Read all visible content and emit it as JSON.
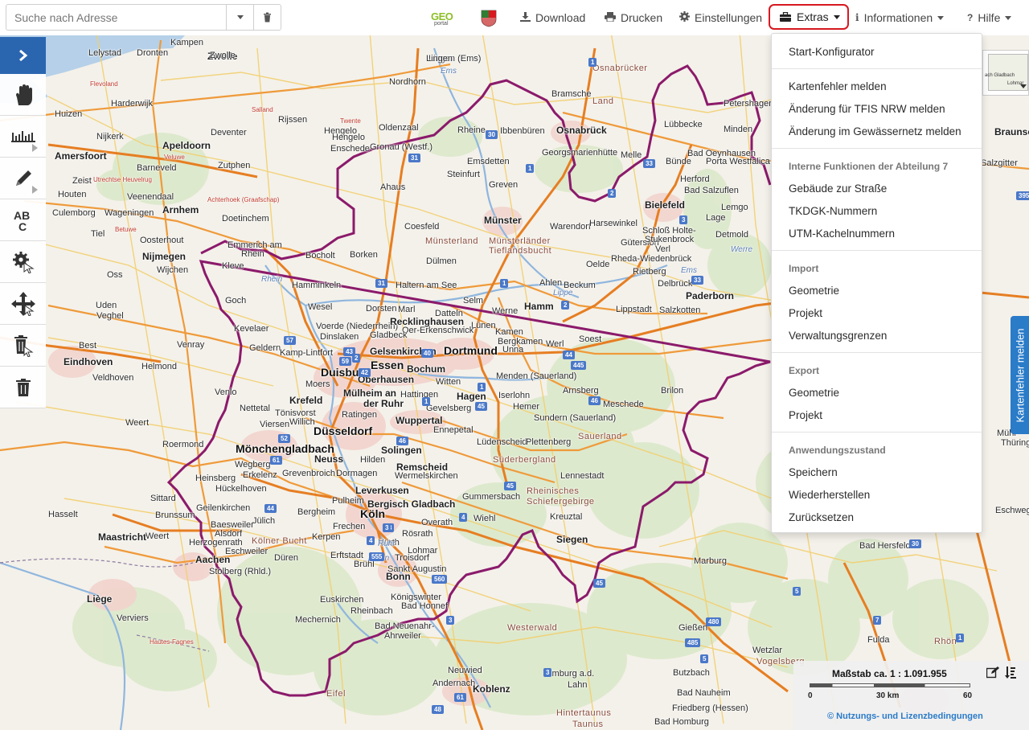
{
  "search": {
    "placeholder": "Suche nach Adresse"
  },
  "nav": {
    "download": "Download",
    "print": "Drucken",
    "settings": "Einstellungen",
    "extras": "Extras",
    "info": "Informationen",
    "help": "Hilfe"
  },
  "logos": {
    "geoportal_top": "GEO",
    "geoportal_bottom": "portal"
  },
  "extras_menu": {
    "start_configurator": "Start-Konfigurator",
    "report_map_error": "Kartenfehler melden",
    "report_tfis_change": "Änderung für TFIS NRW melden",
    "report_water_change": "Änderung im Gewässernetz melden",
    "internal_header": "Interne Funktionen der Abteilung 7",
    "building_street": "Gebäude zur Straße",
    "tkdgk": "TKDGK-Nummern",
    "utm": "UTM-Kachelnummern",
    "import_header": "Import",
    "import_geometry": "Geometrie",
    "import_project": "Projekt",
    "import_admin": "Verwaltungsgrenzen",
    "export_header": "Export",
    "export_geometry": "Geometrie",
    "export_project": "Projekt",
    "state_header": "Anwendungszustand",
    "save": "Speichern",
    "restore": "Wiederherstellen",
    "reset": "Zurücksetzen"
  },
  "report_tab": "Kartenfehler melden",
  "overview": {
    "label1": "ach Gladbach",
    "label2": "Lohmar"
  },
  "scale": {
    "label": "Maßstab ca. 1 : 1.091.955",
    "tick_start": "0",
    "tick_mid": "30 km",
    "tick_end": "60",
    "license": "© Nutzungs- und Lizenzbedingungen"
  },
  "colors": {
    "accent": "#2a66b0",
    "highlight": "#d71920",
    "border_nrw": "#8b1a6b"
  },
  "map": {
    "labels": [
      {
        "t": "Kampen",
        "c": ""
      },
      {
        "t": "Lelystad",
        "c": ""
      },
      {
        "t": "Dronten",
        "c": ""
      },
      {
        "t": "Zwolle",
        "c": "mid"
      },
      {
        "t": "Lingen (Ems)",
        "c": ""
      },
      {
        "t": "Nordhorn",
        "c": ""
      },
      {
        "t": "Osnabrücker",
        "c": "reg"
      },
      {
        "t": "Land",
        "c": "reg"
      },
      {
        "t": "Bramsche",
        "c": ""
      },
      {
        "t": "Petershagen",
        "c": ""
      },
      {
        "t": "Harderwijk",
        "c": ""
      },
      {
        "t": "Flevoland",
        "c": "nl"
      },
      {
        "t": "Salland",
        "c": "nl"
      },
      {
        "t": "Huizen",
        "c": ""
      },
      {
        "t": "Nijkerk",
        "c": ""
      },
      {
        "t": "Rijssen",
        "c": ""
      },
      {
        "t": "Hengelo",
        "c": ""
      },
      {
        "t": "Oldenzaal",
        "c": ""
      },
      {
        "t": "Twente",
        "c": "nl"
      },
      {
        "t": "Rheine",
        "c": ""
      },
      {
        "t": "Ibbenbüren",
        "c": ""
      },
      {
        "t": "Osnabrück",
        "c": "mid"
      },
      {
        "t": "Lübbecke",
        "c": ""
      },
      {
        "t": "Minden",
        "c": ""
      },
      {
        "t": "Amersfoort",
        "c": "mid"
      },
      {
        "t": "Apeldoorn",
        "c": "mid"
      },
      {
        "t": "Veluwe",
        "c": "nl"
      },
      {
        "t": "Deventer",
        "c": ""
      },
      {
        "t": "Hengelo",
        "c": ""
      },
      {
        "t": "Enschede",
        "c": ""
      },
      {
        "t": "Gronau (Westf.)",
        "c": ""
      },
      {
        "t": "Georgsmarienhütte",
        "c": ""
      },
      {
        "t": "Melle",
        "c": ""
      },
      {
        "t": "Bad Oeynhausen",
        "c": ""
      },
      {
        "t": "Porta Westfalica",
        "c": ""
      },
      {
        "t": "Barneveld",
        "c": ""
      },
      {
        "t": "Zutphen",
        "c": ""
      },
      {
        "t": "Emsdetten",
        "c": ""
      },
      {
        "t": "Bünde",
        "c": ""
      },
      {
        "t": "Zeist",
        "c": ""
      },
      {
        "t": "Utrechtse Heuvelrug",
        "c": "nl"
      },
      {
        "t": "Steinfurt",
        "c": ""
      },
      {
        "t": "Herford",
        "c": ""
      },
      {
        "t": "Houten",
        "c": ""
      },
      {
        "t": "Veenendaal",
        "c": ""
      },
      {
        "t": "Achterhoek (Graafschap)",
        "c": "nl"
      },
      {
        "t": "Ahaus",
        "c": ""
      },
      {
        "t": "Greven",
        "c": ""
      },
      {
        "t": "Bad Salzuflen",
        "c": ""
      },
      {
        "t": "Culemborg",
        "c": ""
      },
      {
        "t": "Wageningen",
        "c": ""
      },
      {
        "t": "Arnhem",
        "c": "mid"
      },
      {
        "t": "Doetinchem",
        "c": ""
      },
      {
        "t": "Münster",
        "c": "mid"
      },
      {
        "t": "Warendorf",
        "c": ""
      },
      {
        "t": "Harsewinkel",
        "c": ""
      },
      {
        "t": "Bielefeld",
        "c": "mid"
      },
      {
        "t": "Lemgo",
        "c": ""
      },
      {
        "t": "Tiel",
        "c": ""
      },
      {
        "t": "Betuwe",
        "c": "nl"
      },
      {
        "t": "Coesfeld",
        "c": ""
      },
      {
        "t": "Lage",
        "c": ""
      },
      {
        "t": "Oosterhout",
        "c": ""
      },
      {
        "t": "Emmerich am",
        "c": ""
      },
      {
        "t": "Rhein",
        "c": ""
      },
      {
        "t": "Münsterland",
        "c": "reg"
      },
      {
        "t": "Münsterländer",
        "c": "reg"
      },
      {
        "t": "Tieflandsbucht",
        "c": "reg"
      },
      {
        "t": "Gütersloh",
        "c": ""
      },
      {
        "t": "Schloß Holte-",
        "c": ""
      },
      {
        "t": "Stukenbrock",
        "c": ""
      },
      {
        "t": "Detmold",
        "c": ""
      },
      {
        "t": "Nijmegen",
        "c": "mid"
      },
      {
        "t": "Kleve",
        "c": ""
      },
      {
        "t": "Bocholt",
        "c": ""
      },
      {
        "t": "Borken",
        "c": ""
      },
      {
        "t": "Dülmen",
        "c": ""
      },
      {
        "t": "Rheda-Wiedenbrück",
        "c": ""
      },
      {
        "t": "Verl",
        "c": ""
      },
      {
        "t": "Oss",
        "c": ""
      },
      {
        "t": "Wijchen",
        "c": ""
      },
      {
        "t": "Oelde",
        "c": ""
      },
      {
        "t": "Rietberg",
        "c": ""
      },
      {
        "t": "Hamminkeln",
        "c": ""
      },
      {
        "t": "Haltern am See",
        "c": ""
      },
      {
        "t": "Ahlen",
        "c": ""
      },
      {
        "t": "Beckum",
        "c": ""
      },
      {
        "t": "Delbrück",
        "c": ""
      },
      {
        "t": "Goch",
        "c": ""
      },
      {
        "t": "Wesel",
        "c": ""
      },
      {
        "t": "Marl",
        "c": ""
      },
      {
        "t": "Selm",
        "c": ""
      },
      {
        "t": "Hamm",
        "c": "mid"
      },
      {
        "t": "Paderborn",
        "c": "mid"
      },
      {
        "t": "Uden",
        "c": ""
      },
      {
        "t": "Dorsten",
        "c": ""
      },
      {
        "t": "Datteln",
        "c": ""
      },
      {
        "t": "Werne",
        "c": ""
      },
      {
        "t": "Lippstadt",
        "c": ""
      },
      {
        "t": "Salzkotten",
        "c": ""
      },
      {
        "t": "Veghel",
        "c": ""
      },
      {
        "t": "Kevelaer",
        "c": ""
      },
      {
        "t": "Voerde (Niederrhein)",
        "c": ""
      },
      {
        "t": "Recklinghausen",
        "c": "mid"
      },
      {
        "t": "Lünen",
        "c": ""
      },
      {
        "t": "Dinslaken",
        "c": ""
      },
      {
        "t": "Oer-Erkenschwick",
        "c": ""
      },
      {
        "t": "Kamen",
        "c": ""
      },
      {
        "t": "Gladbeck",
        "c": ""
      },
      {
        "t": "Bergkamen",
        "c": ""
      },
      {
        "t": "Soest",
        "c": ""
      },
      {
        "t": "Best",
        "c": ""
      },
      {
        "t": "Geldern",
        "c": ""
      },
      {
        "t": "Venray",
        "c": ""
      },
      {
        "t": "Kamp-Lintfort",
        "c": ""
      },
      {
        "t": "Gelsenkirchen",
        "c": "mid"
      },
      {
        "t": "Dortmund",
        "c": "big"
      },
      {
        "t": "Unna",
        "c": ""
      },
      {
        "t": "Werl",
        "c": ""
      },
      {
        "t": "Eindhoven",
        "c": "mid"
      },
      {
        "t": "Helmond",
        "c": ""
      },
      {
        "t": "Duisburg",
        "c": "big"
      },
      {
        "t": "Essen",
        "c": "big"
      },
      {
        "t": "Bochum",
        "c": "mid"
      },
      {
        "t": "Oberhausen",
        "c": "mid"
      },
      {
        "t": "Veldhoven",
        "c": ""
      },
      {
        "t": "Moers",
        "c": ""
      },
      {
        "t": "Menden (Sauerland)",
        "c": ""
      },
      {
        "t": "Witten",
        "c": ""
      },
      {
        "t": "Mülheim an",
        "c": "mid"
      },
      {
        "t": "der Ruhr",
        "c": "mid"
      },
      {
        "t": "Arnsberg",
        "c": ""
      },
      {
        "t": "Brilon",
        "c": ""
      },
      {
        "t": "Venlo",
        "c": ""
      },
      {
        "t": "Hattingen",
        "c": ""
      },
      {
        "t": "Hagen",
        "c": "mid"
      },
      {
        "t": "Iserlohn",
        "c": ""
      },
      {
        "t": "Krefeld",
        "c": "mid"
      },
      {
        "t": "Ratingen",
        "c": ""
      },
      {
        "t": "Gevelsberg",
        "c": ""
      },
      {
        "t": "Hemer",
        "c": ""
      },
      {
        "t": "Meschede",
        "c": ""
      },
      {
        "t": "Nettetal",
        "c": ""
      },
      {
        "t": "Tönisvorst",
        "c": ""
      },
      {
        "t": "Sundern (Sauerland)",
        "c": ""
      },
      {
        "t": "Weert",
        "c": ""
      },
      {
        "t": "Viersen",
        "c": ""
      },
      {
        "t": "Willich",
        "c": ""
      },
      {
        "t": "Wuppertal",
        "c": "mid"
      },
      {
        "t": "Düsseldorf",
        "c": "big"
      },
      {
        "t": "Ennepetal",
        "c": ""
      },
      {
        "t": "Roermond",
        "c": ""
      },
      {
        "t": "Lüdenscheid",
        "c": ""
      },
      {
        "t": "Plettenberg",
        "c": ""
      },
      {
        "t": "Sauerland",
        "c": "reg"
      },
      {
        "t": "Mönchengladbach",
        "c": "big"
      },
      {
        "t": "Solingen",
        "c": "mid"
      },
      {
        "t": "Neuss",
        "c": "mid"
      },
      {
        "t": "Hilden",
        "c": ""
      },
      {
        "t": "Süderbergland",
        "c": "reg"
      },
      {
        "t": "Wegberg",
        "c": ""
      },
      {
        "t": "Remscheid",
        "c": "mid"
      },
      {
        "t": "Heinsberg",
        "c": ""
      },
      {
        "t": "Erkelenz",
        "c": ""
      },
      {
        "t": "Grevenbroich",
        "c": ""
      },
      {
        "t": "Dormagen",
        "c": ""
      },
      {
        "t": "Wermelskirchen",
        "c": ""
      },
      {
        "t": "Lennestadt",
        "c": ""
      },
      {
        "t": "Hückelhoven",
        "c": ""
      },
      {
        "t": "Leverkusen",
        "c": "mid"
      },
      {
        "t": "Gummersbach",
        "c": ""
      },
      {
        "t": "Rheinisches",
        "c": "reg"
      },
      {
        "t": "Schiefergebirge",
        "c": "reg"
      },
      {
        "t": "Sittard",
        "c": ""
      },
      {
        "t": "Geilenkirchen",
        "c": ""
      },
      {
        "t": "Pulheim",
        "c": ""
      },
      {
        "t": "Bergisch Gladbach",
        "c": "mid"
      },
      {
        "t": "Brunssum",
        "c": ""
      },
      {
        "t": "Bergheim",
        "c": ""
      },
      {
        "t": "Köln",
        "c": "big"
      },
      {
        "t": "Kreuztal",
        "c": ""
      },
      {
        "t": "Hasselt",
        "c": ""
      },
      {
        "t": "Jülich",
        "c": ""
      },
      {
        "t": "Baesweiler",
        "c": ""
      },
      {
        "t": "Frechen",
        "c": ""
      },
      {
        "t": "Overath",
        "c": ""
      },
      {
        "t": "Wiehl",
        "c": ""
      },
      {
        "t": "Alsdorf",
        "c": ""
      },
      {
        "t": "Kerpen",
        "c": ""
      },
      {
        "t": "Rösrath",
        "c": ""
      },
      {
        "t": "Siegen",
        "c": "mid"
      },
      {
        "t": "Maastricht",
        "c": "mid"
      },
      {
        "t": "Weert",
        "c": ""
      },
      {
        "t": "Herzogenrath",
        "c": ""
      },
      {
        "t": "Kölner Bucht",
        "c": "reg"
      },
      {
        "t": "Eschweiler",
        "c": ""
      },
      {
        "t": "Hürth",
        "c": ""
      },
      {
        "t": "Lohmar",
        "c": ""
      },
      {
        "t": "Düren",
        "c": ""
      },
      {
        "t": "Erftstadt",
        "c": ""
      },
      {
        "t": "Troisdorf",
        "c": ""
      },
      {
        "t": "Aachen",
        "c": "mid"
      },
      {
        "t": "Brühl",
        "c": ""
      },
      {
        "t": "Marburg",
        "c": ""
      },
      {
        "t": "Stolberg (Rhld.)",
        "c": ""
      },
      {
        "t": "Sankt Augustin",
        "c": ""
      },
      {
        "t": "Bonn",
        "c": "mid"
      },
      {
        "t": "Liège",
        "c": "mid"
      },
      {
        "t": "Euskirchen",
        "c": ""
      },
      {
        "t": "Königswinter",
        "c": ""
      },
      {
        "t": "Bad Honnef",
        "c": ""
      },
      {
        "t": "Rheinbach",
        "c": ""
      },
      {
        "t": "Verviers",
        "c": ""
      },
      {
        "t": "Mechernich",
        "c": ""
      },
      {
        "t": "Westerwald",
        "c": "reg"
      },
      {
        "t": "Gießen",
        "c": ""
      },
      {
        "t": "Hautes-Fagnes",
        "c": "nl"
      },
      {
        "t": "Bad Neuenahr-",
        "c": ""
      },
      {
        "t": "Ahrweiler",
        "c": ""
      },
      {
        "t": "Wetzlar",
        "c": ""
      },
      {
        "t": "Vogelsberg",
        "c": "reg"
      },
      {
        "t": "Neuwied",
        "c": ""
      },
      {
        "t": "Limburg a.d.",
        "c": ""
      },
      {
        "t": "Lahn",
        "c": ""
      },
      {
        "t": "Butzbach",
        "c": ""
      },
      {
        "t": "Andernach",
        "c": ""
      },
      {
        "t": "Koblenz",
        "c": "mid"
      },
      {
        "t": "Bad Nauheim",
        "c": ""
      },
      {
        "t": "Eifel",
        "c": "reg"
      },
      {
        "t": "Friedberg (Hessen)",
        "c": ""
      },
      {
        "t": "Hintertaunus",
        "c": "reg"
      },
      {
        "t": "Taunus",
        "c": "reg"
      },
      {
        "t": "Bad Homburg",
        "c": ""
      },
      {
        "t": "Bad Hersfeld",
        "c": ""
      },
      {
        "t": "Fulda",
        "c": ""
      },
      {
        "t": "Rhön",
        "c": "reg"
      },
      {
        "t": "Braunsc",
        "c": "mid"
      },
      {
        "t": "Salzgitter",
        "c": ""
      },
      {
        "t": "Mühl",
        "c": ""
      },
      {
        "t": "Thüringe",
        "c": ""
      },
      {
        "t": "Eschwege",
        "c": ""
      },
      {
        "t": "Ems",
        "c": "river"
      },
      {
        "t": "Werre",
        "c": "river"
      },
      {
        "t": "Rhein",
        "c": "river"
      },
      {
        "t": "Lippe",
        "c": "river"
      },
      {
        "t": "Ems",
        "c": "river"
      },
      {
        "t": "Ruhr",
        "c": "river"
      },
      {
        "t": "Rhein",
        "c": "river"
      },
      {
        "t": "Zwolle",
        "c": ""
      },
      {
        "t": "Olden",
        "c": ""
      },
      {
        "t": "Lingen",
        "c": ""
      }
    ],
    "shields": [
      "1",
      "30",
      "31",
      "1",
      "33",
      "2",
      "3",
      "31",
      "1",
      "2",
      "33",
      "57",
      "43",
      "2",
      "42",
      "59",
      "40",
      "44",
      "445",
      "1",
      "46",
      "45",
      "61",
      "52",
      "46",
      "1",
      "4",
      "44",
      "45",
      "3",
      "555",
      "3",
      "4",
      "560",
      "3",
      "61",
      "48",
      "45",
      "5",
      "7",
      "480",
      "485",
      "5",
      "395",
      "7",
      "30",
      "1",
      "3"
    ]
  }
}
